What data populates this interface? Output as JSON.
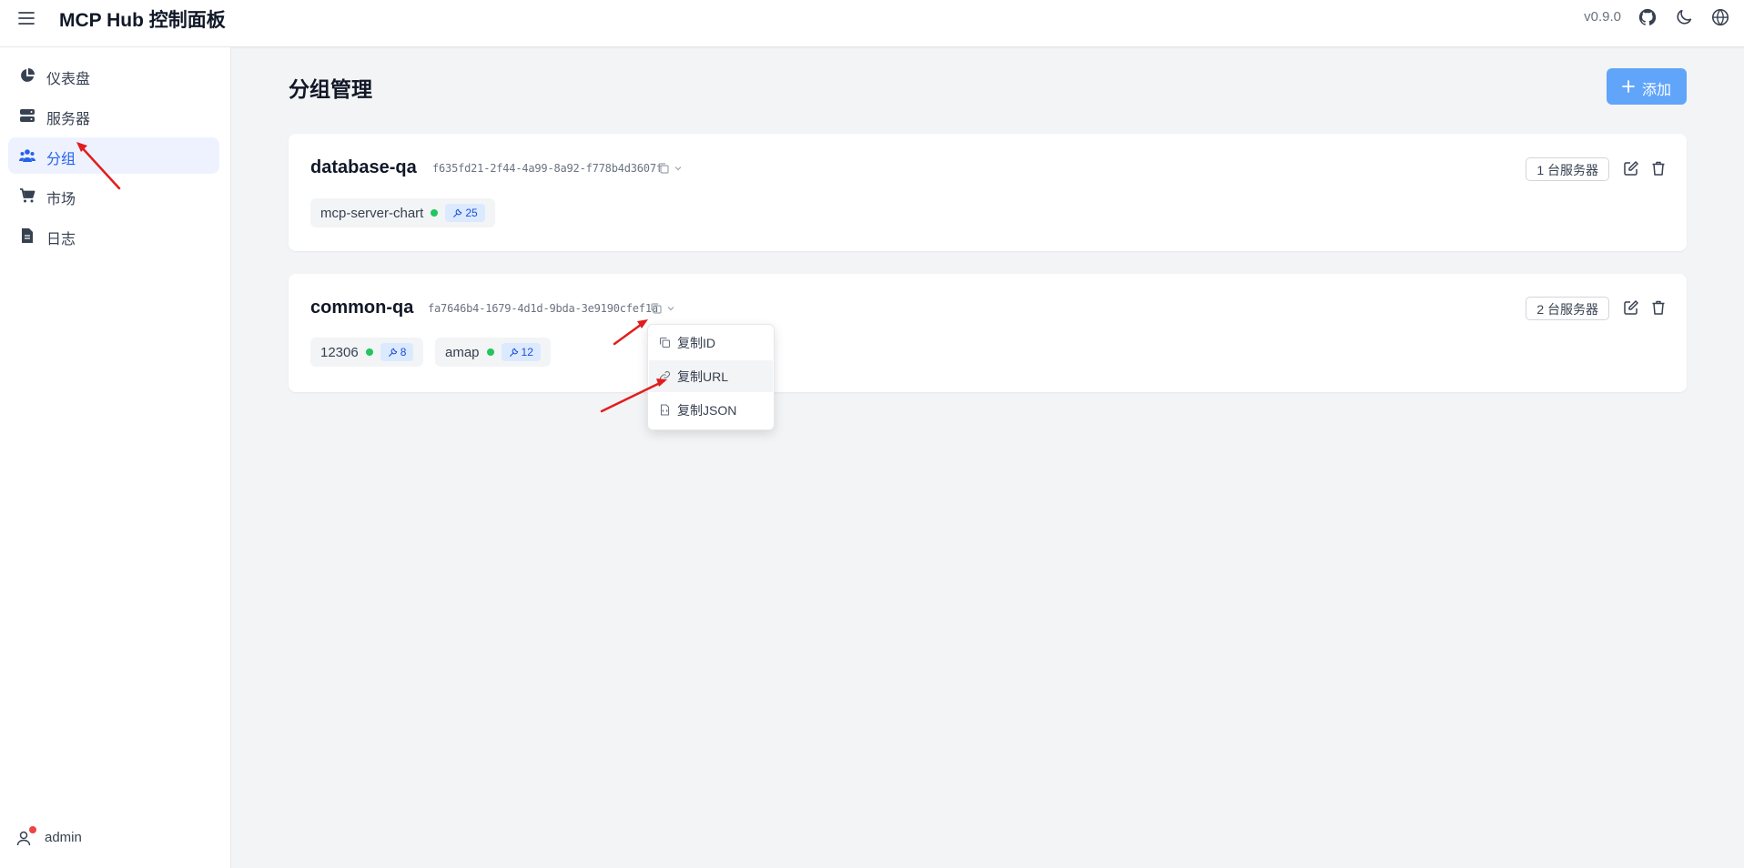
{
  "header": {
    "title": "MCP Hub 控制面板",
    "version": "v0.9.0",
    "icons": [
      "menu-icon",
      "github-icon",
      "moon-icon",
      "globe-icon"
    ]
  },
  "sidebar": {
    "items": [
      {
        "label": "仪表盘",
        "icon": "pie-chart-icon",
        "active": false
      },
      {
        "label": "服务器",
        "icon": "server-icon",
        "active": false
      },
      {
        "label": "分组",
        "icon": "users-icon",
        "active": true
      },
      {
        "label": "市场",
        "icon": "cart-icon",
        "active": false
      },
      {
        "label": "日志",
        "icon": "file-icon",
        "active": false
      }
    ],
    "user": {
      "name": "admin"
    }
  },
  "main": {
    "title": "分组管理",
    "add_label": "添加",
    "groups": [
      {
        "name": "database-qa",
        "id": "f635fd21-2f44-4a99-8a92-f778b4d3607f",
        "server_count": "1 台服务器",
        "servers": [
          {
            "name": "mcp-server-chart",
            "status": "online",
            "tools": "25"
          }
        ]
      },
      {
        "name": "common-qa",
        "id": "fa7646b4-1679-4d1d-9bda-3e9190cfef1a",
        "server_count": "2 台服务器",
        "servers": [
          {
            "name": "12306",
            "status": "online",
            "tools": "8"
          },
          {
            "name": "amap",
            "status": "online",
            "tools": "12"
          }
        ]
      }
    ]
  },
  "dropdown": {
    "items": [
      {
        "label": "复制ID",
        "icon": "copy-icon"
      },
      {
        "label": "复制URL",
        "icon": "link-icon",
        "hovered": true
      },
      {
        "label": "复制JSON",
        "icon": "file-json-icon"
      }
    ]
  },
  "colors": {
    "accent": "#2563eb",
    "add_button": "#60a5fa",
    "status_online": "#22c55e",
    "tool_badge_bg": "#dbeafe",
    "annotation_arrow": "#e11d1d"
  }
}
